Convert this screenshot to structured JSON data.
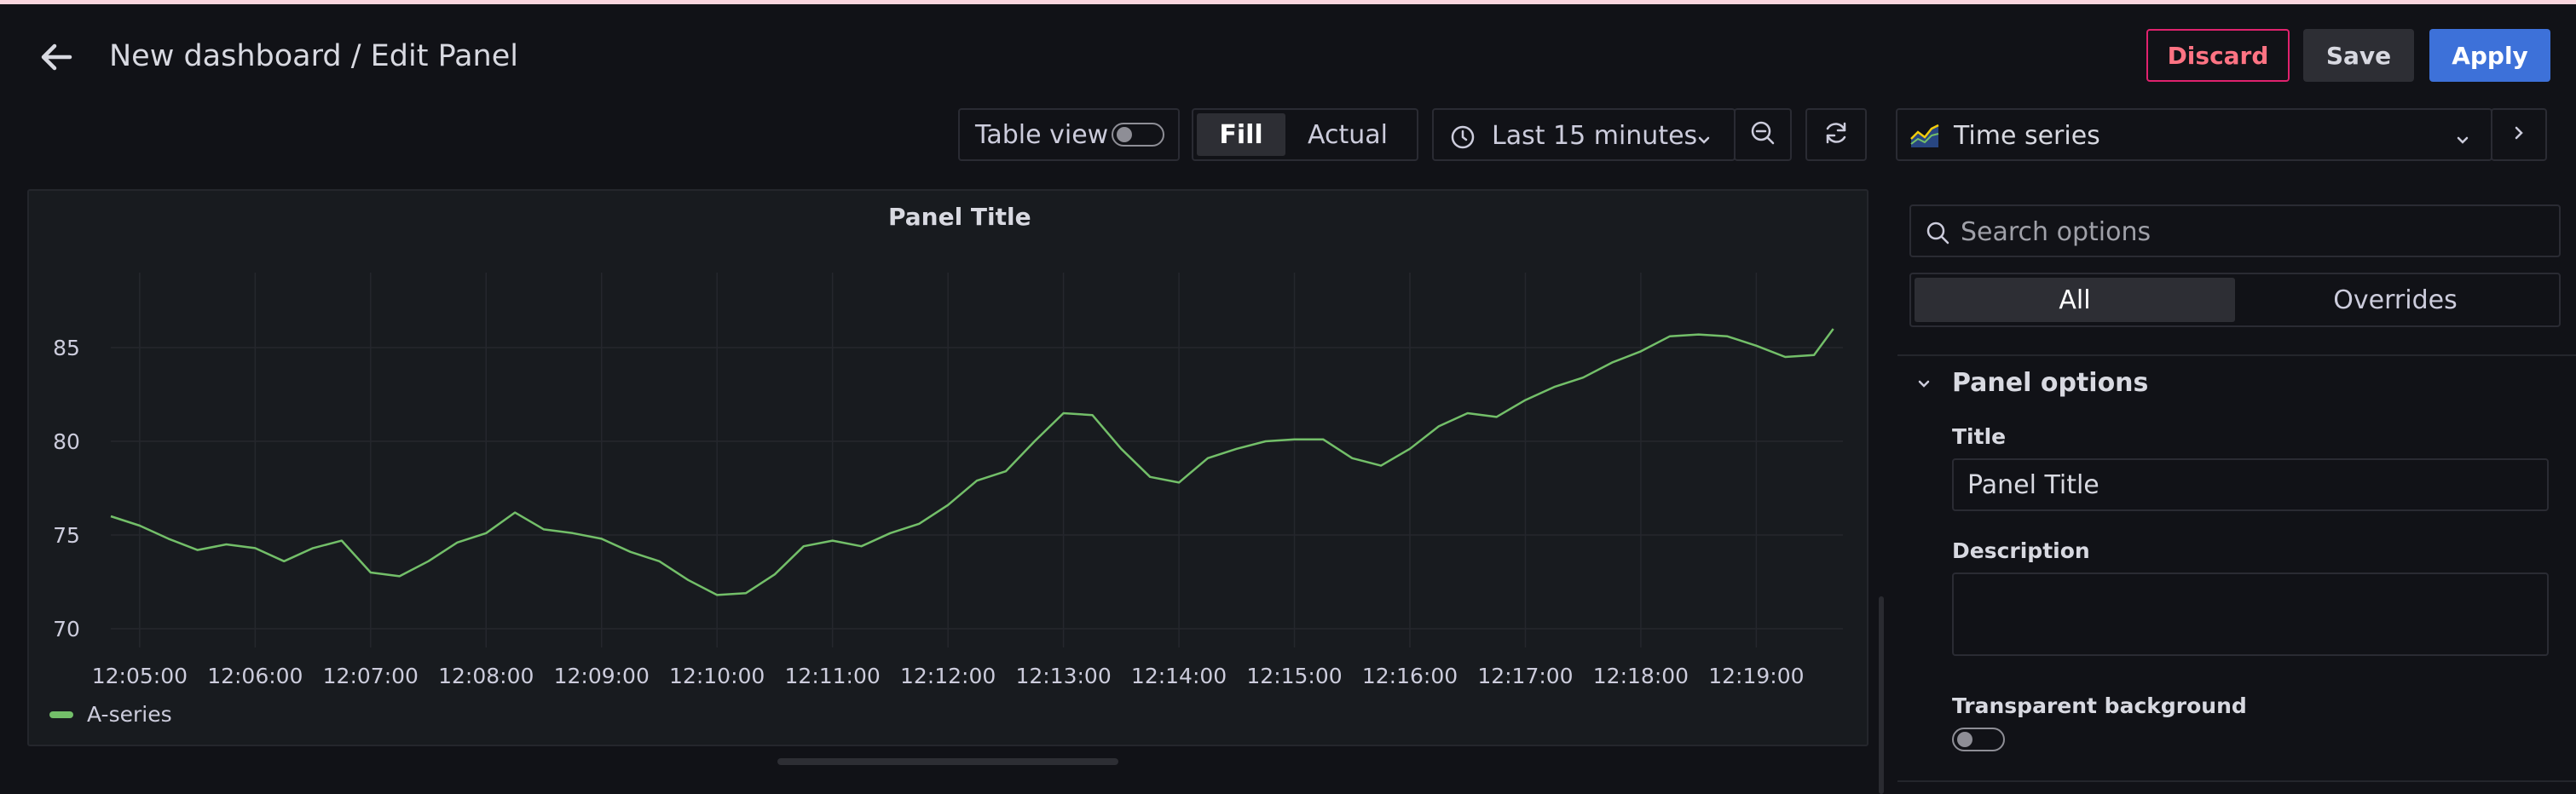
{
  "header": {
    "title": "New dashboard / Edit Panel",
    "discard_label": "Discard",
    "save_label": "Save",
    "apply_label": "Apply"
  },
  "toolbar": {
    "table_view_label": "Table view",
    "table_view_on": false,
    "fill_label": "Fill",
    "actual_label": "Actual",
    "time_range_label": "Last 15 minutes",
    "visualization_label": "Time series"
  },
  "panel": {
    "title": "Panel Title"
  },
  "chart_data": {
    "type": "line",
    "title": "Panel Title",
    "xlabel": "",
    "ylabel": "",
    "x_ticks": [
      "12:05:00",
      "12:06:00",
      "12:07:00",
      "12:08:00",
      "12:09:00",
      "12:10:00",
      "12:11:00",
      "12:12:00",
      "12:13:00",
      "12:14:00",
      "12:15:00",
      "12:16:00",
      "12:17:00",
      "12:18:00",
      "12:19:00"
    ],
    "y_ticks": [
      70,
      75,
      80,
      85
    ],
    "xlim": [
      "12:04:45",
      "12:19:45"
    ],
    "ylim": [
      69,
      89
    ],
    "grid": true,
    "legend": "bottom-left",
    "series": [
      {
        "name": "A-series",
        "color": "#73bf69",
        "x": [
          "12:04:45",
          "12:05:00",
          "12:05:15",
          "12:05:30",
          "12:05:45",
          "12:06:00",
          "12:06:15",
          "12:06:30",
          "12:06:45",
          "12:07:00",
          "12:07:15",
          "12:07:30",
          "12:07:45",
          "12:08:00",
          "12:08:15",
          "12:08:30",
          "12:08:45",
          "12:09:00",
          "12:09:15",
          "12:09:30",
          "12:09:45",
          "12:10:00",
          "12:10:15",
          "12:10:30",
          "12:10:45",
          "12:11:00",
          "12:11:15",
          "12:11:30",
          "12:11:45",
          "12:12:00",
          "12:12:15",
          "12:12:30",
          "12:12:45",
          "12:13:00",
          "12:13:15",
          "12:13:30",
          "12:13:45",
          "12:14:00",
          "12:14:15",
          "12:14:30",
          "12:14:45",
          "12:15:00",
          "12:15:15",
          "12:15:30",
          "12:15:45",
          "12:16:00",
          "12:16:15",
          "12:16:30",
          "12:16:45",
          "12:17:00",
          "12:17:15",
          "12:17:30",
          "12:17:45",
          "12:18:00",
          "12:18:15",
          "12:18:30",
          "12:18:45",
          "12:19:00",
          "12:19:15",
          "12:19:30",
          "12:19:40"
        ],
        "y": [
          76.0,
          75.5,
          74.8,
          74.2,
          74.5,
          74.3,
          73.6,
          74.3,
          74.7,
          73.0,
          72.8,
          73.6,
          74.6,
          75.1,
          76.2,
          75.3,
          75.1,
          74.8,
          74.1,
          73.6,
          72.6,
          71.8,
          71.9,
          72.9,
          74.4,
          74.7,
          74.4,
          75.1,
          75.6,
          76.6,
          77.9,
          78.4,
          80.0,
          81.5,
          81.4,
          79.6,
          78.1,
          77.8,
          79.1,
          79.6,
          80.0,
          80.1,
          80.1,
          79.1,
          78.7,
          79.6,
          80.8,
          81.5,
          81.3,
          82.2,
          82.9,
          83.4,
          84.2,
          84.8,
          85.6,
          85.7,
          85.6,
          85.1,
          84.5,
          84.6,
          86.0
        ]
      }
    ]
  },
  "options": {
    "search_placeholder": "Search options",
    "tab_all": "All",
    "tab_overrides": "Overrides",
    "section_title": "Panel options",
    "title_label": "Title",
    "title_value": "Panel Title",
    "description_label": "Description",
    "description_value": "",
    "transparent_label": "Transparent background",
    "transparent_on": false
  }
}
